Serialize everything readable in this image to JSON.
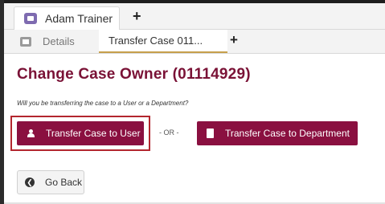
{
  "tabs": {
    "primary_label": "Adam Trainer",
    "add_symbol": "+"
  },
  "subtabs": {
    "details_label": "Details",
    "active_label": "Transfer Case 011...",
    "add_symbol": "+"
  },
  "page": {
    "title": "Change Case Owner (01114929)",
    "question": "Will you be transferring the case to a User or a Department?",
    "transfer_user_label": "Transfer Case to User",
    "or_label": "- OR -",
    "transfer_dept_label": "Transfer Case to Department",
    "go_back_label": "Go Back",
    "go_back_glyph": "❮"
  },
  "colors": {
    "brand": "#8a1040",
    "title": "#7a1236",
    "highlight_border": "#b3262e",
    "tab_accent": "#c69f4b"
  },
  "icons": {
    "primary_tab": "record-icon",
    "details_tab": "record-icon",
    "transfer_user": "user-icon",
    "transfer_dept": "building-icon",
    "go_back": "arrow-left-circle-icon"
  }
}
